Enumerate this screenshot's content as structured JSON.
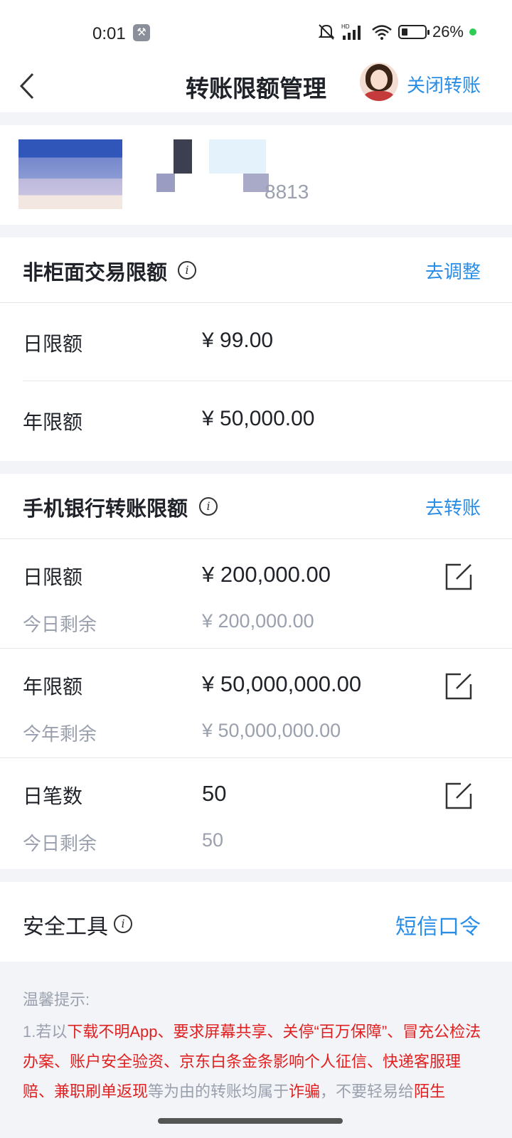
{
  "status_bar": {
    "time": "0:01",
    "battery": "26%"
  },
  "nav": {
    "title": "转账限额管理",
    "close_label": "关闭转账"
  },
  "account": {
    "number_tail": "8813"
  },
  "counter": {
    "title": "非柜面交易限额",
    "action": "去调整",
    "rows": [
      {
        "label": "日限额",
        "value": "¥ 99.00"
      },
      {
        "label": "年限额",
        "value": "¥ 50,000.00"
      }
    ]
  },
  "mobile": {
    "title": "手机银行转账限额",
    "action": "去转账",
    "rows": [
      {
        "label": "日限额",
        "value": "¥ 200,000.00",
        "sub_label": "今日剩余",
        "sub_value": "¥ 200,000.00"
      },
      {
        "label": "年限额",
        "value": "¥ 50,000,000.00",
        "sub_label": "今年剩余",
        "sub_value": "¥ 50,000,000.00"
      },
      {
        "label": "日笔数",
        "value": "50",
        "sub_label": "今日剩余",
        "sub_value": "50"
      }
    ]
  },
  "security": {
    "title": "安全工具",
    "action": "短信口令"
  },
  "tips": {
    "title": "温馨提示:",
    "p1": "1.若以",
    "r1": "下载不明App、要求屏幕共享、关停“百万保障”、冒充公检法办案、账户安全验资、京东白条金条影响个人征信、快递客服理赔、兼职刷单返现",
    "p2": "等为由的转账均属于",
    "r2": "诈骗",
    "p3": "，不要轻易给",
    "r3": "陌生"
  },
  "colors": {
    "link": "#2a8de6",
    "warning": "#e02020",
    "muted": "#9aa0ad"
  }
}
